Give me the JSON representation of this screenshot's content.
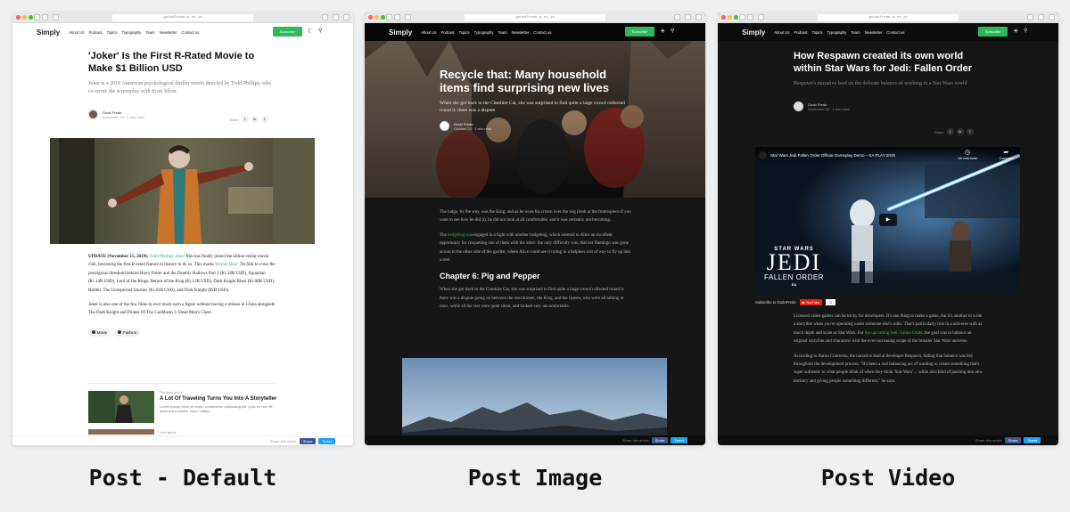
{
  "url": "gododfredo.w.ss.js",
  "nav": {
    "logo": "Simply",
    "items": [
      "About Us",
      "Podcast",
      "Topics",
      "Typography",
      "Team",
      "Newsletter",
      "Contact us"
    ],
    "subscribe": "Subscribe"
  },
  "post_default": {
    "title": "'Joker' Is the First R-Rated Movie to Make $1 Billion USD",
    "lede": "Joker is a 2019 American psychological thriller movie directed by Todd Phillips, who co-wrote the screenplay with Scott Silver",
    "author": "Godo Fredo",
    "date": "November 15 · 1 min read",
    "share": "Share",
    "p1_a": "UPDATE (November 15, 2019):",
    "p1_link": "Todd Phillips' Joker",
    "p1_b": "film has finally joined the billion-dollar movie club, becoming the first R-rated feature in history to do so. This marks",
    "p1_link2": "Warner Bros'",
    "p1_c": "7th film to cross the prestigious threshold behind Harry Potter and the Deathly Hallows Part 2 ($1.34B USD), Aquaman ($1.14B USD), Lord of the Rings: Return of the King ($1.12B USD), Dark Knight Rises ($1.08B USD), Hobbit: The Unexpected Journey ($1.01B USD), and Dark Knight ($1B USD).",
    "p2": "Joker is also one of the few films to ever reach such a figure without having a release in China alongside The Dark Knight and Pirates Of The Caribbean 2: Dead Man's Chest.",
    "tags": [
      "Movie",
      "Fashion"
    ],
    "prev_label": "Previous article",
    "prev_title": "A Lot Of Traveling Turns You Into A Storyteller",
    "prev_excerpt": "Lorem ipsum dolor sit amet, consectetur adipisicing elit. Quis eu nisi elit amet dolor nullam. Nunc mattis...",
    "next_label": "Next article"
  },
  "post_image": {
    "title": "Recycle that: Many household items find surprising new lives",
    "lede": "When she got back to the Cheshire Cat, she was surprised to find quite a large crowd collected round it: there was a dispute",
    "author": "Godo Fredo",
    "date": "October 24 · 1 min read",
    "p1": "The judge, by the way, was the King; and as he wore his crown over the wig (look at the frontispiece if you want to see how he did it), he did not look at all comfortable, and it was certainly not becoming.",
    "p2_a": "The",
    "p2_link": "hedgehog was",
    "p2_b": "engaged in a fight with another hedgehog, which seemed to Alice an excellent opportunity for croqueting one of them with the other: the only difficulty was, that her flamingo was gone across to the other side of the garden, where Alice could see it trying in a helpless sort of way to fly up into a tree.",
    "h2": "Chapter 6: Pig and Pepper",
    "p3": "When she got back to the Cheshire Cat, she was surprised to find quite a large crowd collected round it: there was a dispute going on between the executioner, the King, and the Queen, who were all talking at once, while all the rest were quite silent, and looked very uncomfortable."
  },
  "post_video": {
    "title": "How Respawn created its own world within Star Wars for Jedi: Fallen Order",
    "lede": "Respawn's narrative lead on the delicate balance of working in a Star Wars world",
    "author": "Godo Fredo",
    "date": "November 15 · 1 min read",
    "share": "Share",
    "video_title": "Star Wars Jedi Fallen Order Official Gameplay Demo – EA PLAY 2019",
    "watch_later": "Ver más tarde",
    "share_video": "Compartir",
    "logo_star": "STAR WARS",
    "logo_jedi": "JEDI",
    "logo_sub": "FALLEN ORDER",
    "logo_ea": "EA",
    "subscribe_to": "Subscribe to GodoFredo",
    "youtube": "YouTube",
    "yt_count": "0",
    "p1_a": "Licensed video games can be tricky for developers. It's one thing to make a game, but it's another to write a storyline when you're operating under someone else's rules. That's particularly true in a universe with as much depth and scale as Star Wars. For",
    "p1_link": "the upcoming Jedi: Fallen Order",
    "p1_b": ", the goal was to balance an original storyline and characters with the ever-increasing scope of the broader Star Wars universe.",
    "p2": "According to Aaron Contreras, the narrative lead at developer Respawn, hitting that balance was key throughout the development process. \"It's been a real balancing act of wanting to create something that's super authentic to what people think of when they think 'Star Wars' ... while also kind of pushing into new territory and giving people something different,\" he says."
  },
  "share_bar": {
    "label": "Share this article",
    "facebook": "Share",
    "twitter": "Tweet"
  },
  "captions": [
    "Post - Default",
    "Post Image",
    "Post Video"
  ],
  "colors": {
    "accent": "#2fb85e",
    "facebook": "#3b5998",
    "twitter": "#1da1f2",
    "dark_bg": "#161616"
  }
}
